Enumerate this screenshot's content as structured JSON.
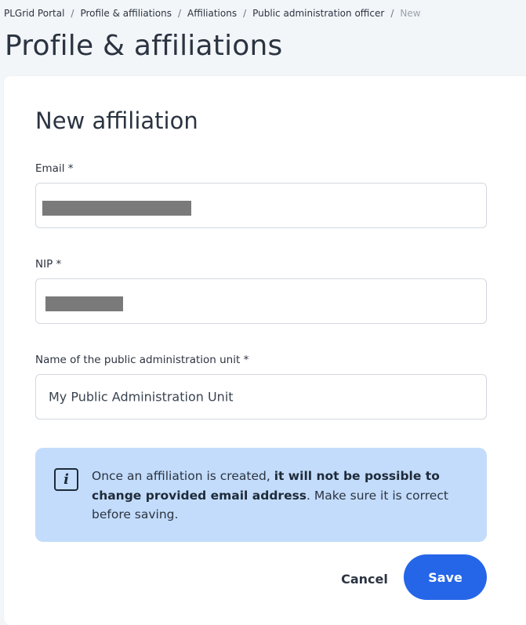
{
  "breadcrumb": {
    "items": [
      "PLGrid Portal",
      "Profile & affiliations",
      "Affiliations",
      "Public administration officer"
    ],
    "current": "New",
    "separator": "/"
  },
  "page": {
    "title": "Profile & affiliations"
  },
  "form": {
    "title": "New affiliation",
    "email": {
      "label": "Email *",
      "value": ""
    },
    "nip": {
      "label": "NIP *",
      "value": ""
    },
    "unit_name": {
      "label": "Name of the public administration unit *",
      "value": "My Public Administration Unit"
    }
  },
  "notice": {
    "icon": "info-icon",
    "icon_glyph": "i",
    "text_before": "Once an affiliation is created, ",
    "text_bold": "it will not be possible to change provided email address",
    "text_after": ". Make sure it is correct before saving."
  },
  "actions": {
    "cancel_label": "Cancel",
    "save_label": "Save"
  },
  "colors": {
    "accent": "#2566e8",
    "notice_bg": "#c3dcfb",
    "page_bg": "#f3f6f9"
  }
}
